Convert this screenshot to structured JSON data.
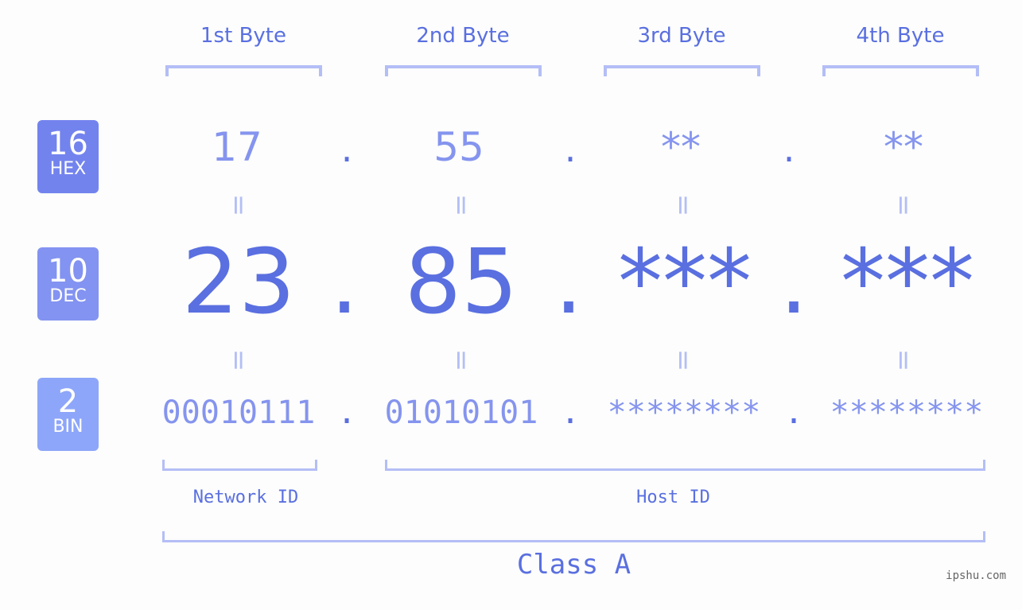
{
  "bytes": [
    {
      "header": "1st Byte",
      "hex": "17",
      "dec": "23",
      "bin": "00010111"
    },
    {
      "header": "2nd Byte",
      "hex": "55",
      "dec": "85",
      "bin": "01010101"
    },
    {
      "header": "3rd Byte",
      "hex": "**",
      "dec": "***",
      "bin": "********"
    },
    {
      "header": "4th Byte",
      "hex": "**",
      "dec": "***",
      "bin": "********"
    }
  ],
  "bases": {
    "hex": {
      "number": "16",
      "label": "HEX",
      "color": "#7383ee"
    },
    "dec": {
      "number": "10",
      "label": "DEC",
      "color": "#8393f1"
    },
    "bin": {
      "number": "2",
      "label": "BIN",
      "color": "#8da6f9"
    }
  },
  "separator": ".",
  "equals": "=",
  "segments": {
    "network": "Network ID",
    "host": "Host ID"
  },
  "class_label": "Class A",
  "watermark": "ipshu.com",
  "colors": {
    "primary": "#5a6fe0",
    "secondary": "#8594ee",
    "bracket": "#b4bef6"
  }
}
